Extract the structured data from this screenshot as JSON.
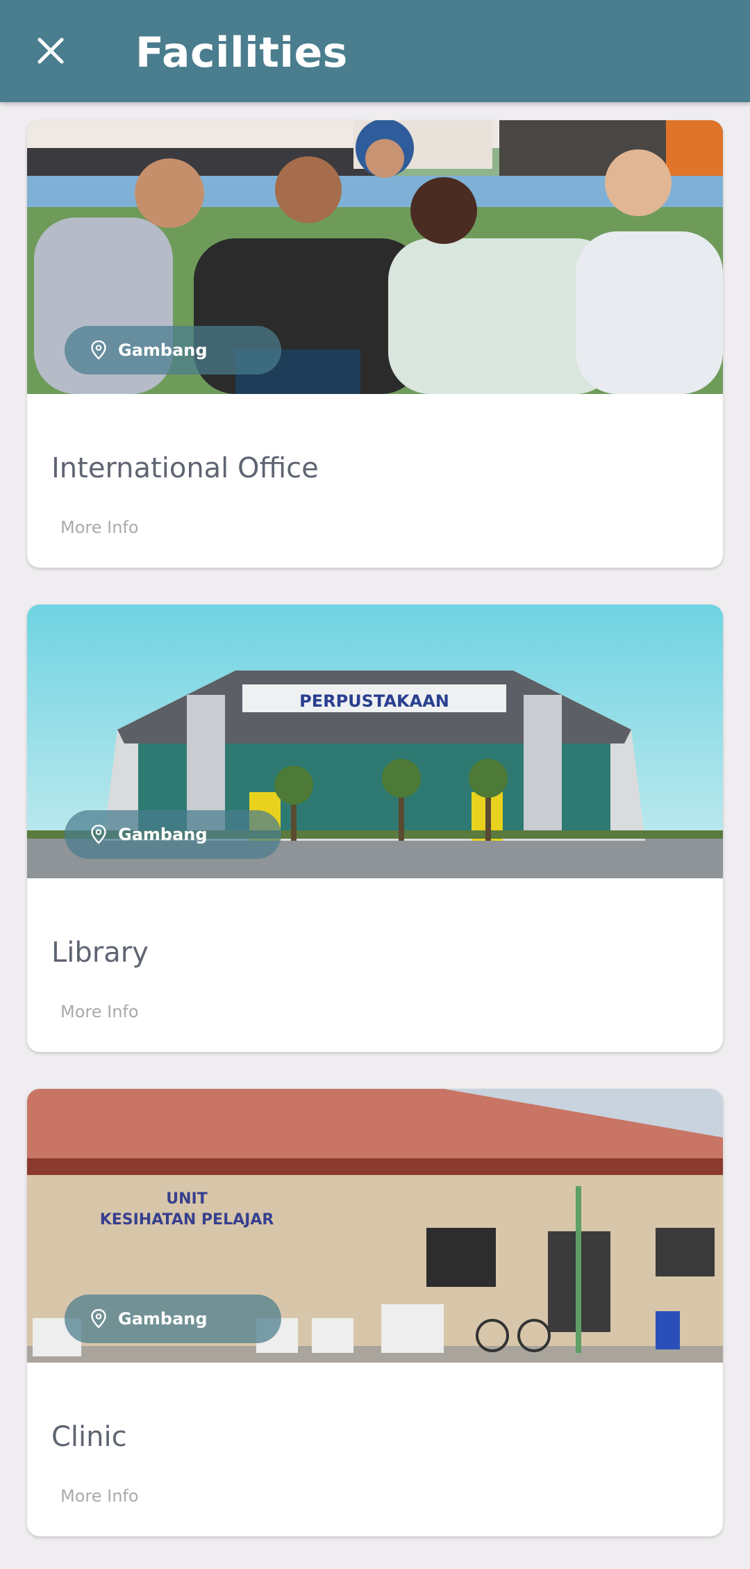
{
  "header": {
    "title": "Facilities",
    "close_icon": "close-icon",
    "color": "#4a7d8e"
  },
  "facilities": [
    {
      "title": "International Office",
      "location": "Gambang",
      "more_info": "More Info",
      "image": "group-of-international-students-photo"
    },
    {
      "title": "Library",
      "location": "Gambang",
      "more_info": "More Info",
      "image": "library-building-photo",
      "sign_text": "PERPUSTAKAAN"
    },
    {
      "title": "Clinic",
      "location": "Gambang",
      "more_info": "More Info",
      "image": "clinic-building-photo",
      "sign_text_line1": "UNIT",
      "sign_text_line2": "KESIHATAN PELAJAR"
    }
  ]
}
